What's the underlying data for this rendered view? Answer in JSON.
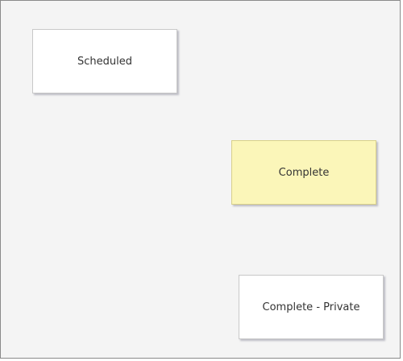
{
  "cards": [
    {
      "label": "Scheduled",
      "background": "#ffffff"
    },
    {
      "label": "Complete",
      "background": "#fbf6b9"
    },
    {
      "label": "Complete - Private",
      "background": "#ffffff"
    }
  ],
  "colors": {
    "canvas_background": "#f4f4f4",
    "canvas_border": "#8a8a8a",
    "card_shadow": "#7878a0"
  }
}
